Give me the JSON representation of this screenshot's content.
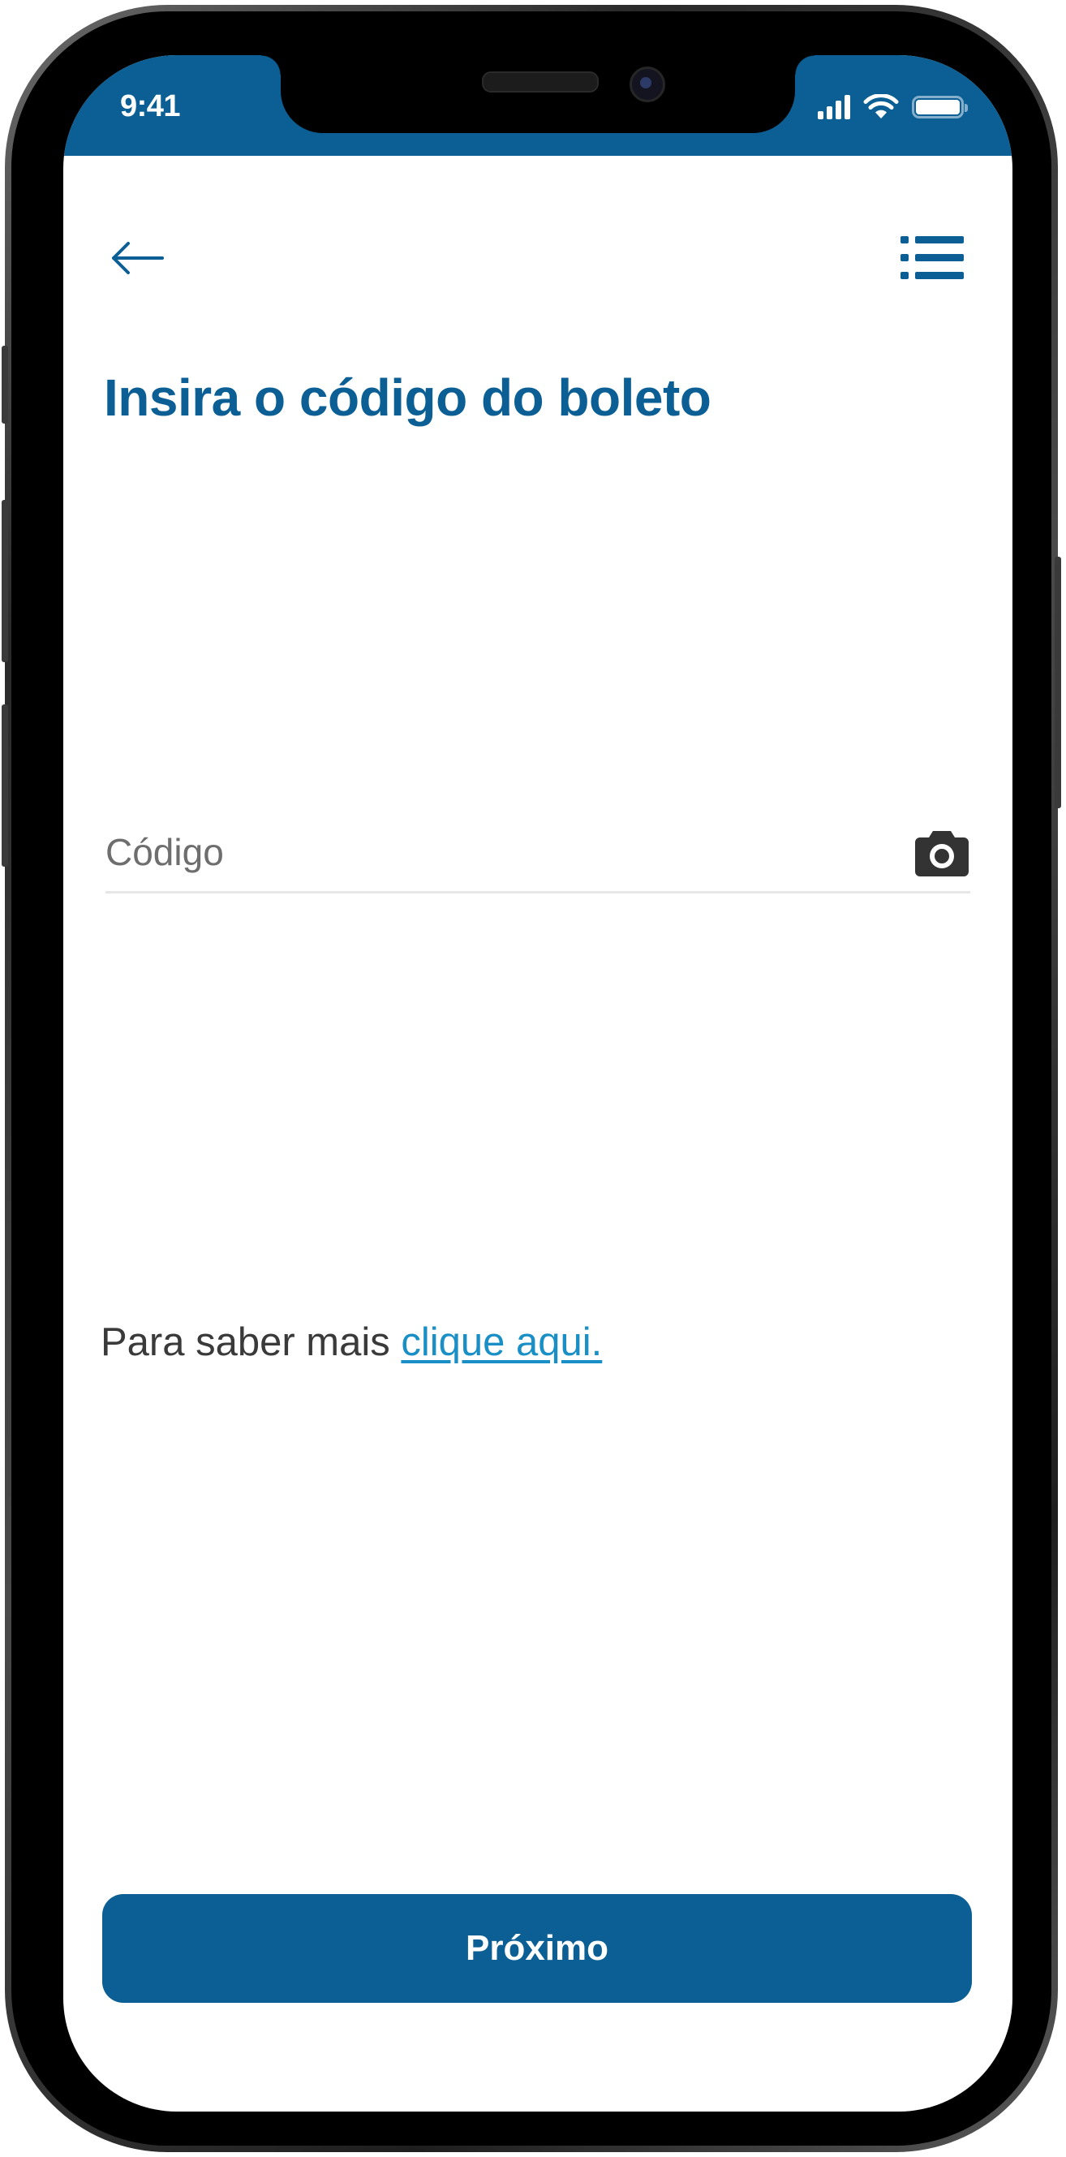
{
  "status_bar": {
    "time": "9:41",
    "icons": [
      "signal-icon",
      "wifi-icon",
      "battery-icon"
    ]
  },
  "header": {
    "back_icon": "arrow-left-icon",
    "menu_icon": "list-icon"
  },
  "main": {
    "title": "Insira o código do boleto",
    "code_field": {
      "value": "",
      "placeholder": "Código",
      "icon": "camera-icon"
    },
    "info_text": "Para saber mais",
    "info_link": "clique aqui."
  },
  "footer": {
    "next_label": "Próximo"
  },
  "colors": {
    "primary": "#0b5f94",
    "link": "#1a8fc6",
    "text": "#3a3a3a",
    "divider": "#e6e6e6"
  }
}
